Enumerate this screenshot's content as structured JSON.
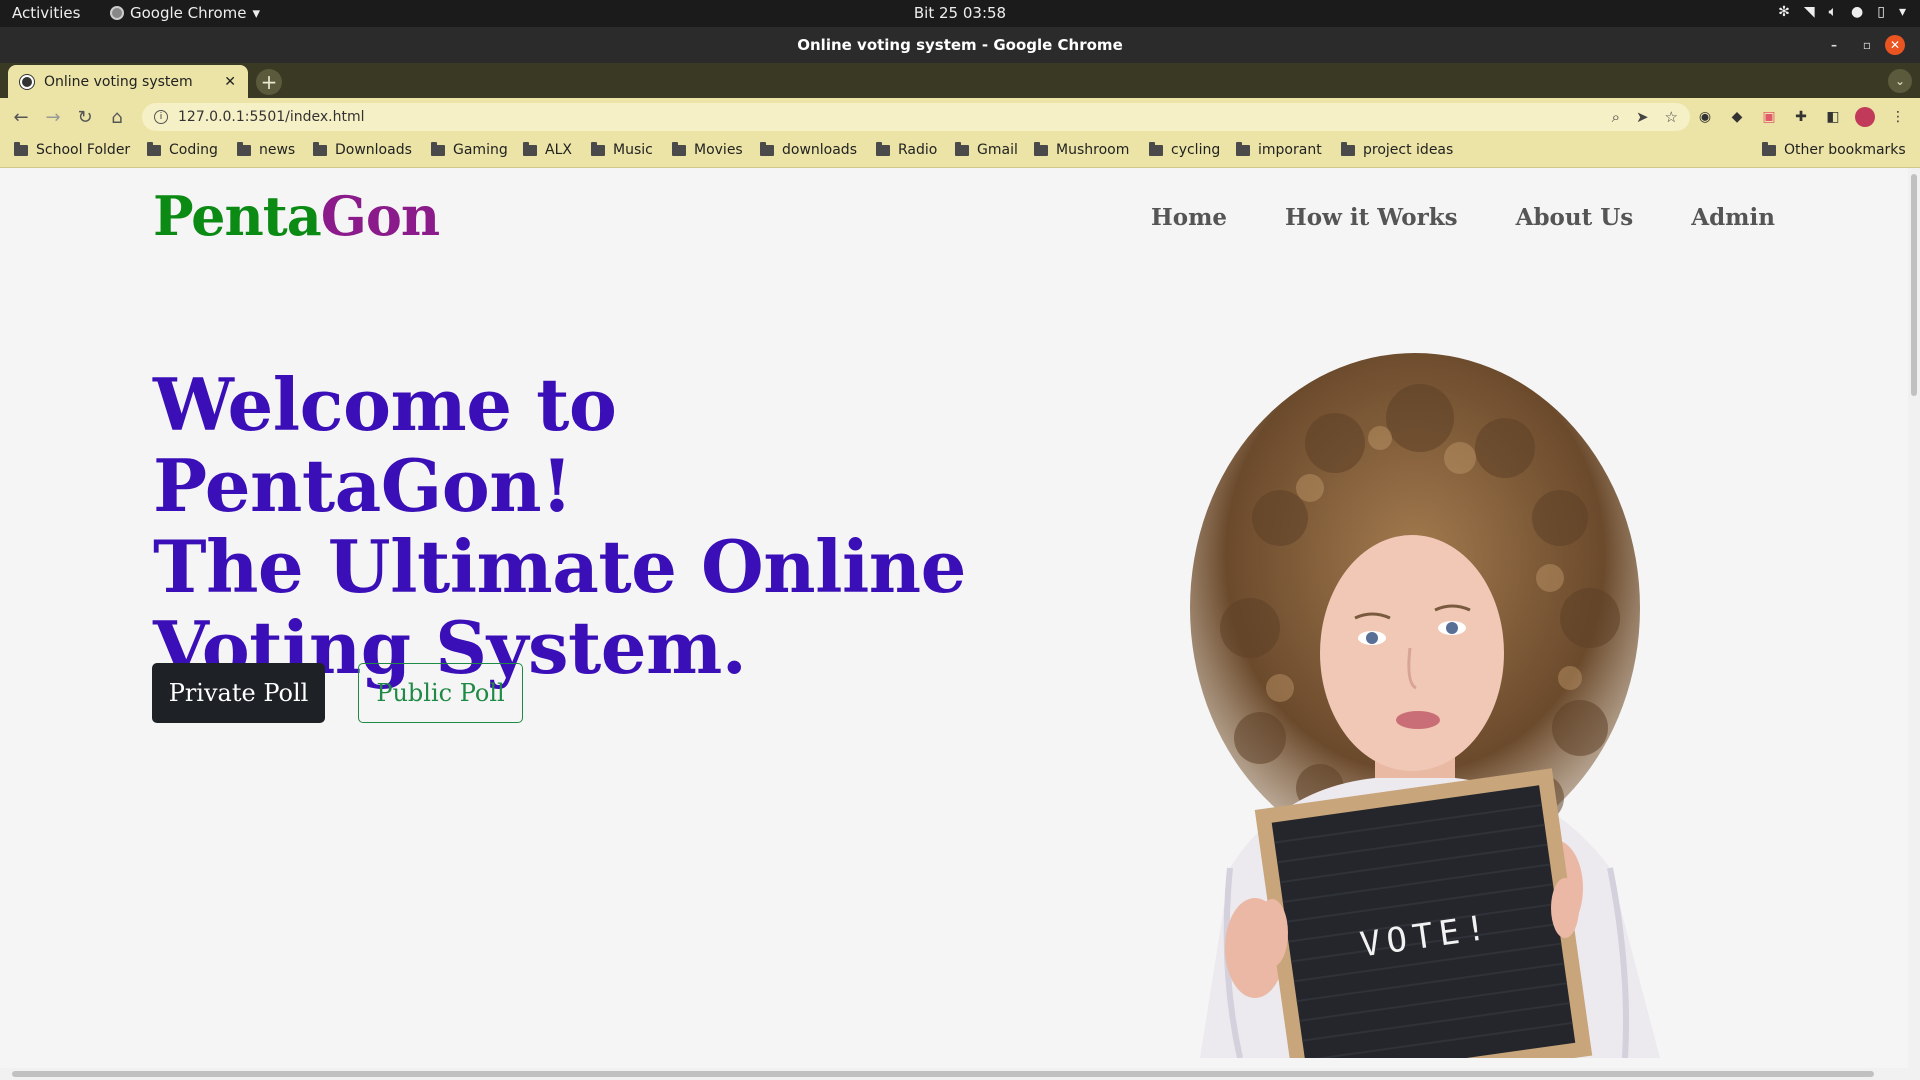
{
  "os": {
    "activities": "Activities",
    "app_name": "Google Chrome",
    "clock": "Bit 25  03:58"
  },
  "window": {
    "title": "Online voting system - Google Chrome"
  },
  "tab": {
    "title": "Online voting system"
  },
  "omnibox": {
    "url": "127.0.0.1:5501/index.html"
  },
  "bookmarks": {
    "items": [
      "School Folder",
      "Coding",
      "news",
      "Downloads",
      "Gaming",
      "ALX",
      "Music",
      "Movies",
      "downloads",
      "Radio",
      "Gmail",
      "Mushroom",
      "cycling",
      "imporant",
      "project ideas"
    ],
    "other": "Other bookmarks"
  },
  "page": {
    "brand_part1": "Penta",
    "brand_part2": "Gon",
    "nav": [
      "Home",
      "How it Works",
      "About Us",
      "Admin"
    ],
    "hero_lines": [
      "Welcome to PentaGon!",
      "The Ultimate Online",
      "Voting System."
    ],
    "private_poll": "Private Poll",
    "public_poll": "Public Poll",
    "sign_text": "VOTE!"
  },
  "colors": {
    "brand_green": "#0b8a14",
    "brand_purple": "#8b1a8b",
    "hero_text": "#3a0fb8",
    "public_btn": "#1f8a45",
    "private_btn": "#1e2226",
    "chrome_theme": "#ece4a6"
  }
}
